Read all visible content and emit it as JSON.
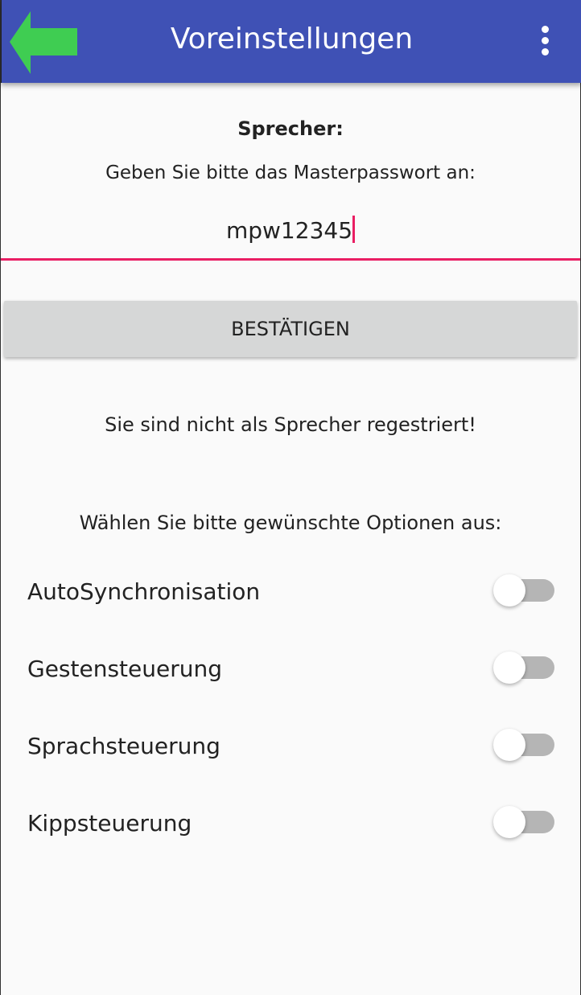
{
  "header": {
    "title": "Voreinstellungen"
  },
  "speaker": {
    "heading": "Sprecher:",
    "prompt": "Geben Sie bitte das Masterpasswort an:",
    "password_value": "mpw12345",
    "confirm_label": "BESTÄTIGEN",
    "status": "Sie sind nicht als Sprecher regestriert!"
  },
  "options": {
    "prompt": "Wählen Sie bitte gewünschte Optionen aus:",
    "items": [
      {
        "label": "AutoSynchronisation",
        "on": false
      },
      {
        "label": "Gestensteuerung",
        "on": false
      },
      {
        "label": "Sprachsteuerung",
        "on": false
      },
      {
        "label": "Kippsteuerung",
        "on": false
      }
    ]
  },
  "colors": {
    "appbar": "#3f51b5",
    "back_arrow": "#3fcd52",
    "accent": "#e91e63"
  }
}
